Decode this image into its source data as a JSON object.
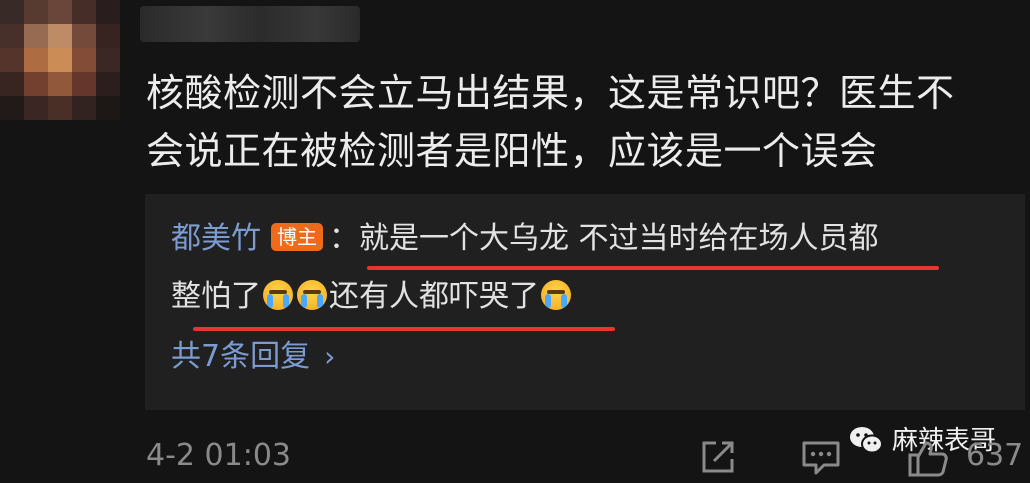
{
  "comment": {
    "line1": "核酸检测不会立马出结果，这是常识吧？医生不",
    "line2": "会说正在被检测者是阳性，应该是一个误会",
    "timestamp": "4-2 01:03",
    "like_count": "637"
  },
  "reply": {
    "author": "都美竹",
    "badge": "博主",
    "separator": "：",
    "line1_text": "就是一个大乌龙 不过当时给在场人员都",
    "line2_a": "整怕了",
    "line2_b": "还有人都吓哭了",
    "more_label": "共7条回复",
    "more_chevron": "›",
    "emoji_name": "crying-face-icon"
  },
  "watermark": {
    "text": "麻辣表哥"
  },
  "colors": {
    "background": "#141414",
    "reply_background": "#202020",
    "link_blue": "#7b9bd1",
    "badge_orange": "#ef6a1b",
    "underline_red": "#e8352e",
    "muted_gray": "#8a8a8a"
  }
}
